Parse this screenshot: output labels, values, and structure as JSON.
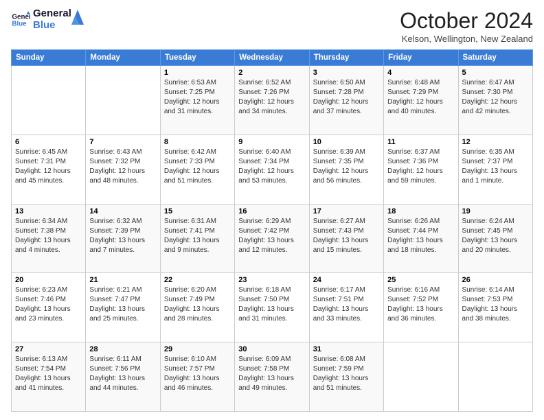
{
  "header": {
    "logo_line1": "General",
    "logo_line2": "Blue",
    "month_title": "October 2024",
    "location": "Kelson, Wellington, New Zealand"
  },
  "days_of_week": [
    "Sunday",
    "Monday",
    "Tuesday",
    "Wednesday",
    "Thursday",
    "Friday",
    "Saturday"
  ],
  "weeks": [
    [
      {
        "day": "",
        "info": ""
      },
      {
        "day": "",
        "info": ""
      },
      {
        "day": "1",
        "info": "Sunrise: 6:53 AM\nSunset: 7:25 PM\nDaylight: 12 hours and 31 minutes."
      },
      {
        "day": "2",
        "info": "Sunrise: 6:52 AM\nSunset: 7:26 PM\nDaylight: 12 hours and 34 minutes."
      },
      {
        "day": "3",
        "info": "Sunrise: 6:50 AM\nSunset: 7:28 PM\nDaylight: 12 hours and 37 minutes."
      },
      {
        "day": "4",
        "info": "Sunrise: 6:48 AM\nSunset: 7:29 PM\nDaylight: 12 hours and 40 minutes."
      },
      {
        "day": "5",
        "info": "Sunrise: 6:47 AM\nSunset: 7:30 PM\nDaylight: 12 hours and 42 minutes."
      }
    ],
    [
      {
        "day": "6",
        "info": "Sunrise: 6:45 AM\nSunset: 7:31 PM\nDaylight: 12 hours and 45 minutes."
      },
      {
        "day": "7",
        "info": "Sunrise: 6:43 AM\nSunset: 7:32 PM\nDaylight: 12 hours and 48 minutes."
      },
      {
        "day": "8",
        "info": "Sunrise: 6:42 AM\nSunset: 7:33 PM\nDaylight: 12 hours and 51 minutes."
      },
      {
        "day": "9",
        "info": "Sunrise: 6:40 AM\nSunset: 7:34 PM\nDaylight: 12 hours and 53 minutes."
      },
      {
        "day": "10",
        "info": "Sunrise: 6:39 AM\nSunset: 7:35 PM\nDaylight: 12 hours and 56 minutes."
      },
      {
        "day": "11",
        "info": "Sunrise: 6:37 AM\nSunset: 7:36 PM\nDaylight: 12 hours and 59 minutes."
      },
      {
        "day": "12",
        "info": "Sunrise: 6:35 AM\nSunset: 7:37 PM\nDaylight: 13 hours and 1 minute."
      }
    ],
    [
      {
        "day": "13",
        "info": "Sunrise: 6:34 AM\nSunset: 7:38 PM\nDaylight: 13 hours and 4 minutes."
      },
      {
        "day": "14",
        "info": "Sunrise: 6:32 AM\nSunset: 7:39 PM\nDaylight: 13 hours and 7 minutes."
      },
      {
        "day": "15",
        "info": "Sunrise: 6:31 AM\nSunset: 7:41 PM\nDaylight: 13 hours and 9 minutes."
      },
      {
        "day": "16",
        "info": "Sunrise: 6:29 AM\nSunset: 7:42 PM\nDaylight: 13 hours and 12 minutes."
      },
      {
        "day": "17",
        "info": "Sunrise: 6:27 AM\nSunset: 7:43 PM\nDaylight: 13 hours and 15 minutes."
      },
      {
        "day": "18",
        "info": "Sunrise: 6:26 AM\nSunset: 7:44 PM\nDaylight: 13 hours and 18 minutes."
      },
      {
        "day": "19",
        "info": "Sunrise: 6:24 AM\nSunset: 7:45 PM\nDaylight: 13 hours and 20 minutes."
      }
    ],
    [
      {
        "day": "20",
        "info": "Sunrise: 6:23 AM\nSunset: 7:46 PM\nDaylight: 13 hours and 23 minutes."
      },
      {
        "day": "21",
        "info": "Sunrise: 6:21 AM\nSunset: 7:47 PM\nDaylight: 13 hours and 25 minutes."
      },
      {
        "day": "22",
        "info": "Sunrise: 6:20 AM\nSunset: 7:49 PM\nDaylight: 13 hours and 28 minutes."
      },
      {
        "day": "23",
        "info": "Sunrise: 6:18 AM\nSunset: 7:50 PM\nDaylight: 13 hours and 31 minutes."
      },
      {
        "day": "24",
        "info": "Sunrise: 6:17 AM\nSunset: 7:51 PM\nDaylight: 13 hours and 33 minutes."
      },
      {
        "day": "25",
        "info": "Sunrise: 6:16 AM\nSunset: 7:52 PM\nDaylight: 13 hours and 36 minutes."
      },
      {
        "day": "26",
        "info": "Sunrise: 6:14 AM\nSunset: 7:53 PM\nDaylight: 13 hours and 38 minutes."
      }
    ],
    [
      {
        "day": "27",
        "info": "Sunrise: 6:13 AM\nSunset: 7:54 PM\nDaylight: 13 hours and 41 minutes."
      },
      {
        "day": "28",
        "info": "Sunrise: 6:11 AM\nSunset: 7:56 PM\nDaylight: 13 hours and 44 minutes."
      },
      {
        "day": "29",
        "info": "Sunrise: 6:10 AM\nSunset: 7:57 PM\nDaylight: 13 hours and 46 minutes."
      },
      {
        "day": "30",
        "info": "Sunrise: 6:09 AM\nSunset: 7:58 PM\nDaylight: 13 hours and 49 minutes."
      },
      {
        "day": "31",
        "info": "Sunrise: 6:08 AM\nSunset: 7:59 PM\nDaylight: 13 hours and 51 minutes."
      },
      {
        "day": "",
        "info": ""
      },
      {
        "day": "",
        "info": ""
      }
    ]
  ]
}
